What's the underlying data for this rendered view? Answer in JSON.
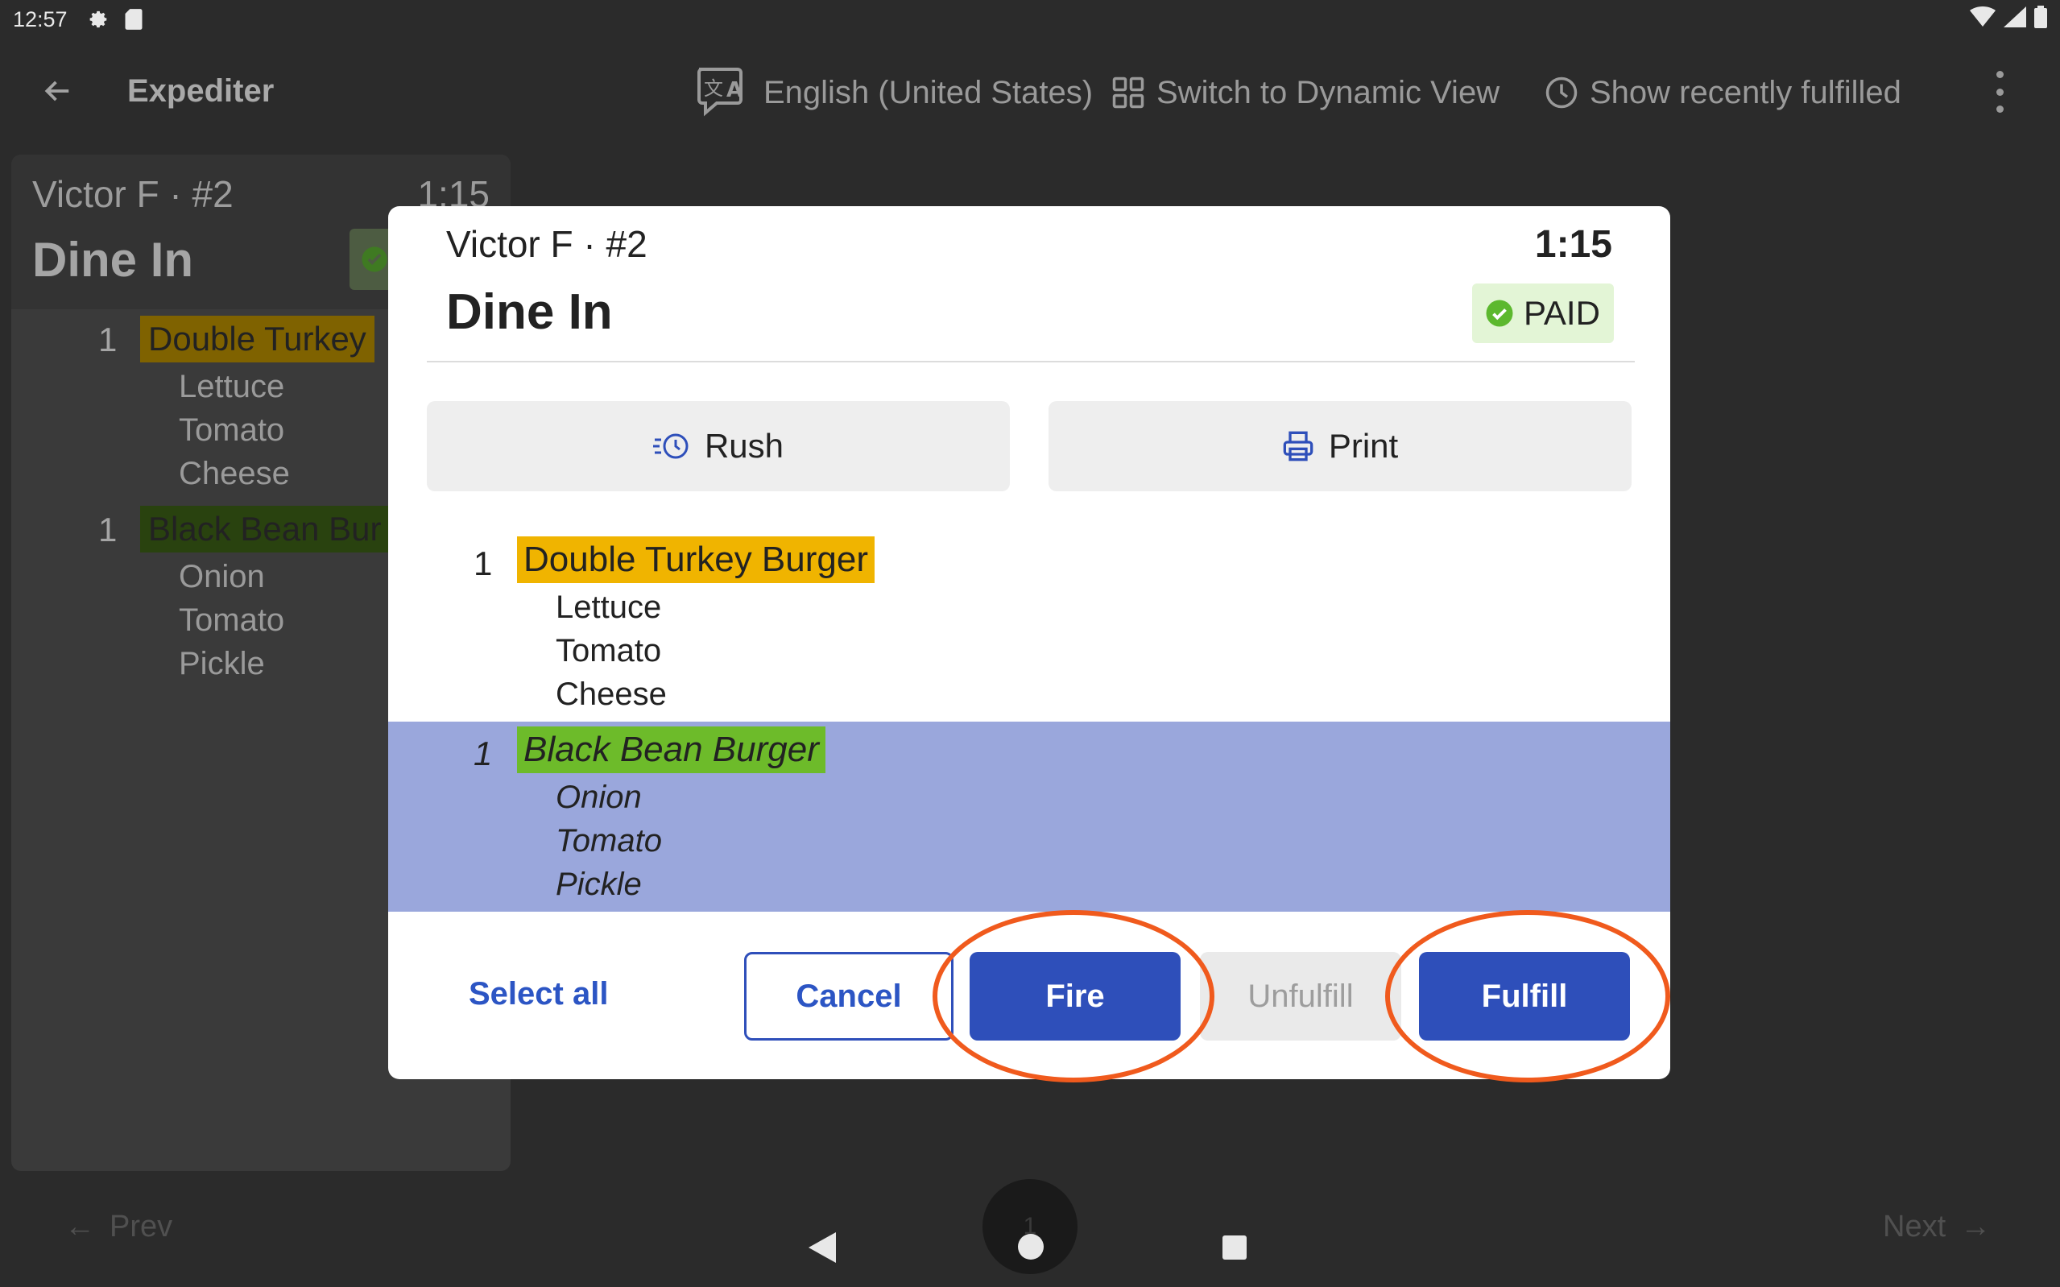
{
  "status_bar": {
    "time": "12:57"
  },
  "app_bar": {
    "title": "Expediter",
    "language": "English (United States)",
    "dynamic_view": "Switch to Dynamic View",
    "recently_fulfilled": "Show recently fulfilled"
  },
  "background_ticket": {
    "customer": "Victor F · #2",
    "elapsed": "1:15",
    "order_type": "Dine In",
    "items": [
      {
        "qty": "1",
        "name": "Double Turkey",
        "modifiers": [
          "Lettuce",
          "Tomato",
          "Cheese"
        ]
      },
      {
        "qty": "1",
        "name": "Black Bean Bur",
        "modifiers": [
          "Onion",
          "Tomato",
          "Pickle"
        ]
      }
    ]
  },
  "dialog": {
    "customer": "Victor F · #2",
    "elapsed": "1:15",
    "order_type": "Dine In",
    "status": "PAID",
    "rush_label": "Rush",
    "print_label": "Print",
    "items": [
      {
        "qty": "1",
        "name": "Double Turkey Burger",
        "highlight": "#f0b400",
        "selected": false,
        "modifiers": [
          "Lettuce",
          "Tomato",
          "Cheese"
        ]
      },
      {
        "qty": "1",
        "name": "Black Bean Burger",
        "highlight": "#6dbb2a",
        "selected": true,
        "modifiers": [
          "Onion",
          "Tomato",
          "Pickle"
        ]
      }
    ],
    "select_all_label": "Select all",
    "cancel_label": "Cancel",
    "fire_label": "Fire",
    "unfulfill_label": "Unfulfill",
    "fulfill_label": "Fulfill"
  },
  "bottom_nav": {
    "prev": "Prev",
    "next": "Next",
    "page": "1"
  },
  "colors": {
    "primary": "#2e4fba",
    "paid_bg": "#e3f5d6",
    "paid_icon": "#5cb82e",
    "selected_row": "#9aa7dc",
    "annotation": "#f05a1d"
  }
}
